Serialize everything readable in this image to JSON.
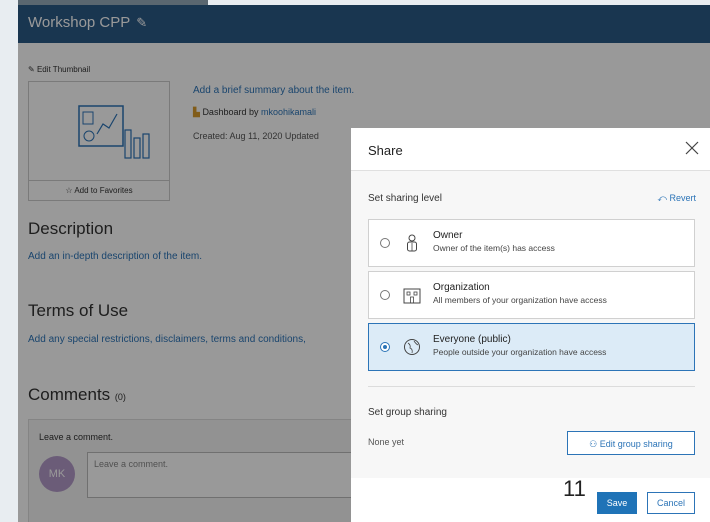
{
  "page": {
    "title": "Workshop CPP",
    "edit_thumbnail": "Edit Thumbnail",
    "add_to_favorites": "Add to Favorites",
    "summary_link": "Add a brief summary about the item.",
    "dashboard_prefix": "Dashboard by",
    "dashboard_owner": "mkoohikamali",
    "created": "Created: Aug 11, 2020   Updated",
    "description_heading": "Description",
    "description_link": "Add an in-depth description of the item.",
    "terms_heading": "Terms of Use",
    "terms_link": "Add any special restrictions, disclaimers, terms and conditions,",
    "comments_heading": "Comments",
    "comments_count": "(0)",
    "leave_comment_label": "Leave a comment.",
    "avatar_initials": "MK",
    "comment_placeholder": "Leave a comment."
  },
  "share": {
    "title": "Share",
    "level_label": "Set sharing level",
    "revert": "Revert",
    "options": [
      {
        "title": "Owner",
        "desc": "Owner of the item(s) has access",
        "selected": false
      },
      {
        "title": "Organization",
        "desc": "All members of your organization have access",
        "selected": false
      },
      {
        "title": "Everyone (public)",
        "desc": "People outside your organization have access",
        "selected": true
      }
    ],
    "group_label": "Set group sharing",
    "none_yet": "None yet",
    "edit_group": "Edit group sharing",
    "save": "Save",
    "cancel": "Cancel",
    "page_number": "11"
  },
  "colors": {
    "accent": "#2c74b7",
    "header": "#2a5a86",
    "selected_bg": "#dcebf7"
  }
}
